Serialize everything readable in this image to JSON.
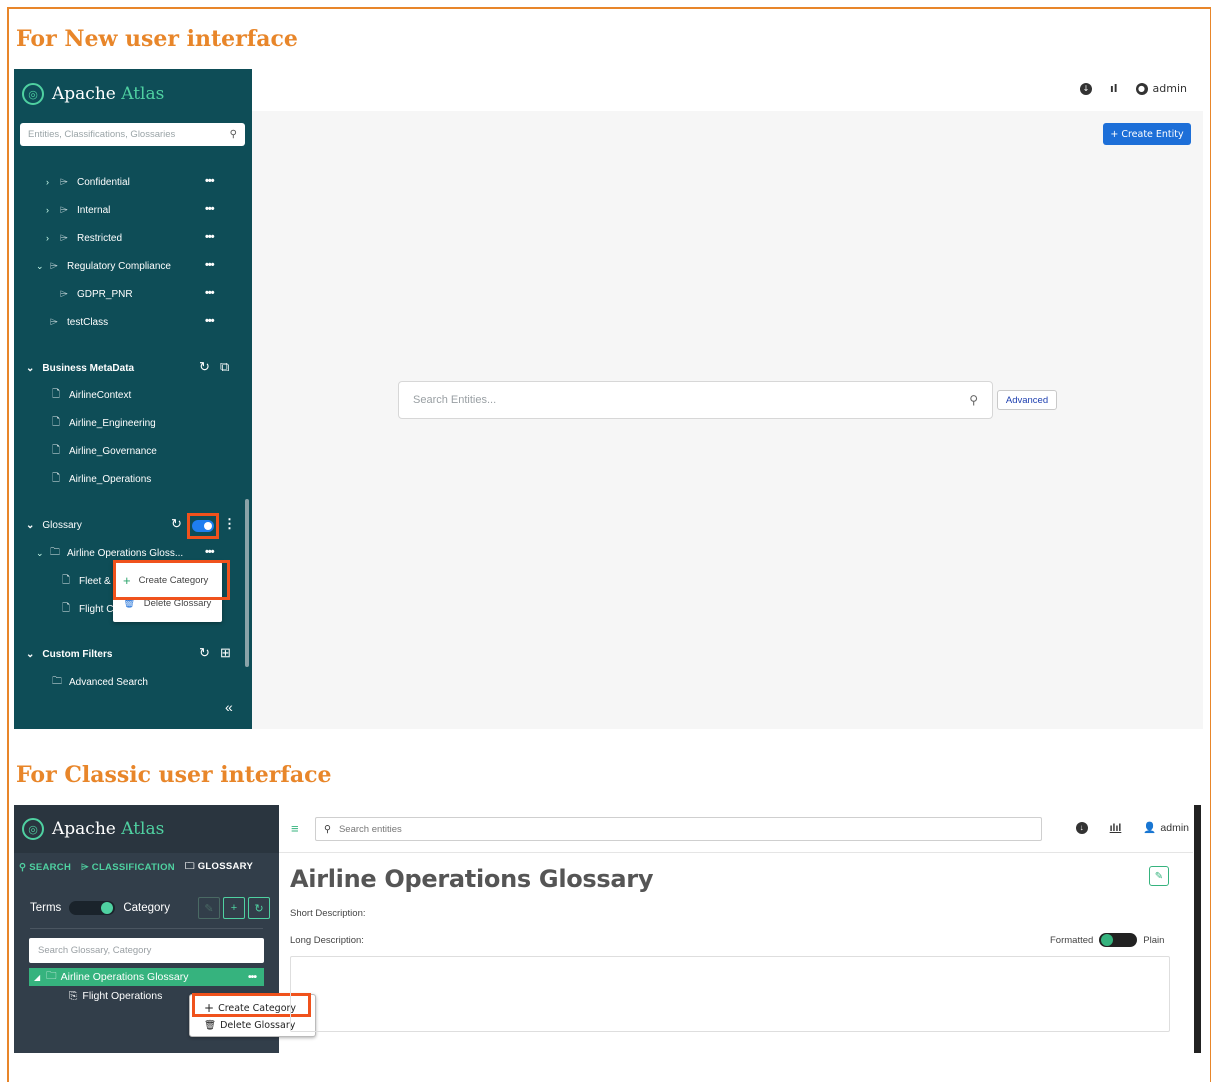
{
  "headings": {
    "new_ui": "For New user interface",
    "classic_ui": "For Classic user interface"
  },
  "new_ui": {
    "brand": {
      "name_a": "Apache ",
      "name_b": "Atlas"
    },
    "search": {
      "placeholder": "Entities, Classifications, Glossaries"
    },
    "classification_items": [
      {
        "label": "Confidential",
        "expandable": true
      },
      {
        "label": "Internal",
        "expandable": true
      },
      {
        "label": "Restricted",
        "expandable": true
      },
      {
        "label": "Regulatory Compliance",
        "expandable": true,
        "expanded": true
      },
      {
        "label": "GDPR_PNR",
        "expandable": false
      },
      {
        "label": "testClass",
        "expandable": false
      }
    ],
    "business_metadata": {
      "title": "Business MetaData",
      "items": [
        "AirlineContext",
        "Airline_Engineering",
        "Airline_Governance",
        "Airline_Operations"
      ]
    },
    "glossary": {
      "title": "Glossary",
      "glossary_item": "Airline Operations Gloss...",
      "children": [
        "Fleet &",
        "Flight C"
      ]
    },
    "context_menu": {
      "create": "Create Category",
      "delete": "Delete Glossary"
    },
    "custom_filters": {
      "title": "Custom Filters",
      "items": [
        "Advanced Search"
      ]
    },
    "topbar": {
      "user": "admin"
    },
    "create_entity": "+ Create Entity",
    "entity_search": {
      "placeholder": "Search Entities..."
    },
    "advanced": "Advanced"
  },
  "classic_ui": {
    "brand": {
      "name_a": "Apache ",
      "name_b": "Atlas"
    },
    "tabs": [
      "SEARCH",
      "CLASSIFICATION",
      "GLOSSARY"
    ],
    "terms_label": "Terms",
    "category_label": "Category",
    "search": {
      "placeholder": "Search Glossary, Category"
    },
    "glossary_item": "Airline Operations Glossary",
    "child_item": "Flight Operations",
    "context_menu": {
      "create": "Create Category",
      "delete": "Delete Glossary"
    },
    "top_search": {
      "placeholder": "Search entities"
    },
    "user": "admin",
    "page_title": "Airline Operations Glossary",
    "short_description_label": "Short Description:",
    "long_description_label": "Long Description:",
    "formatted_label": "Formatted",
    "plain_label": "Plain"
  },
  "colors": {
    "accent_orange": "#e8862a",
    "highlight": "#f0521c",
    "new_sidebar": "#0e4d57",
    "classic_sidebar": "#323e4a",
    "green": "#36b37e",
    "blue": "#1d6fd8"
  }
}
